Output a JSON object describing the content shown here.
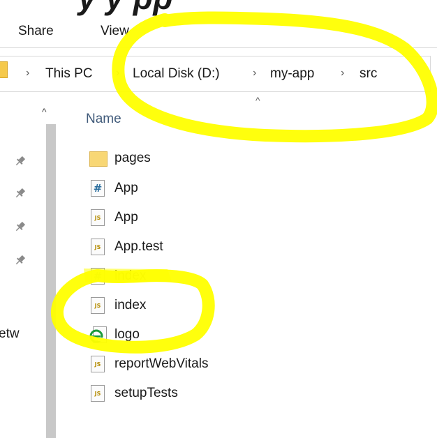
{
  "page_heading": "y              y  pp",
  "ribbon": {
    "tabs": [
      "Share",
      "View"
    ]
  },
  "address_bar": {
    "crumbs": [
      "This PC",
      "Local Disk (D:)",
      "my-app",
      "src"
    ],
    "separator": "›"
  },
  "nav": {
    "network_label": "etw",
    "scroll_up_glyph": "^",
    "pin_glyph": "📌"
  },
  "file_list": {
    "column_name": "Name",
    "sort_glyph": "^",
    "files": [
      {
        "name": "pages",
        "icon": "folder-icon"
      },
      {
        "name": "App",
        "icon": "css-file-icon"
      },
      {
        "name": "App",
        "icon": "js-file-icon"
      },
      {
        "name": "App.test",
        "icon": "js-file-icon"
      },
      {
        "name": "index",
        "icon": "css-file-icon"
      },
      {
        "name": "index",
        "icon": "js-file-icon"
      },
      {
        "name": "logo",
        "icon": "svg-edge-file-icon"
      },
      {
        "name": "reportWebVitals",
        "icon": "js-file-icon"
      },
      {
        "name": "setupTests",
        "icon": "js-file-icon"
      }
    ]
  },
  "colors": {
    "highlighter": "#ffff00",
    "folder": "#f8d775",
    "header_text": "#405a7a"
  },
  "icon_glyphs": {
    "js": "JS",
    "css": "#"
  }
}
